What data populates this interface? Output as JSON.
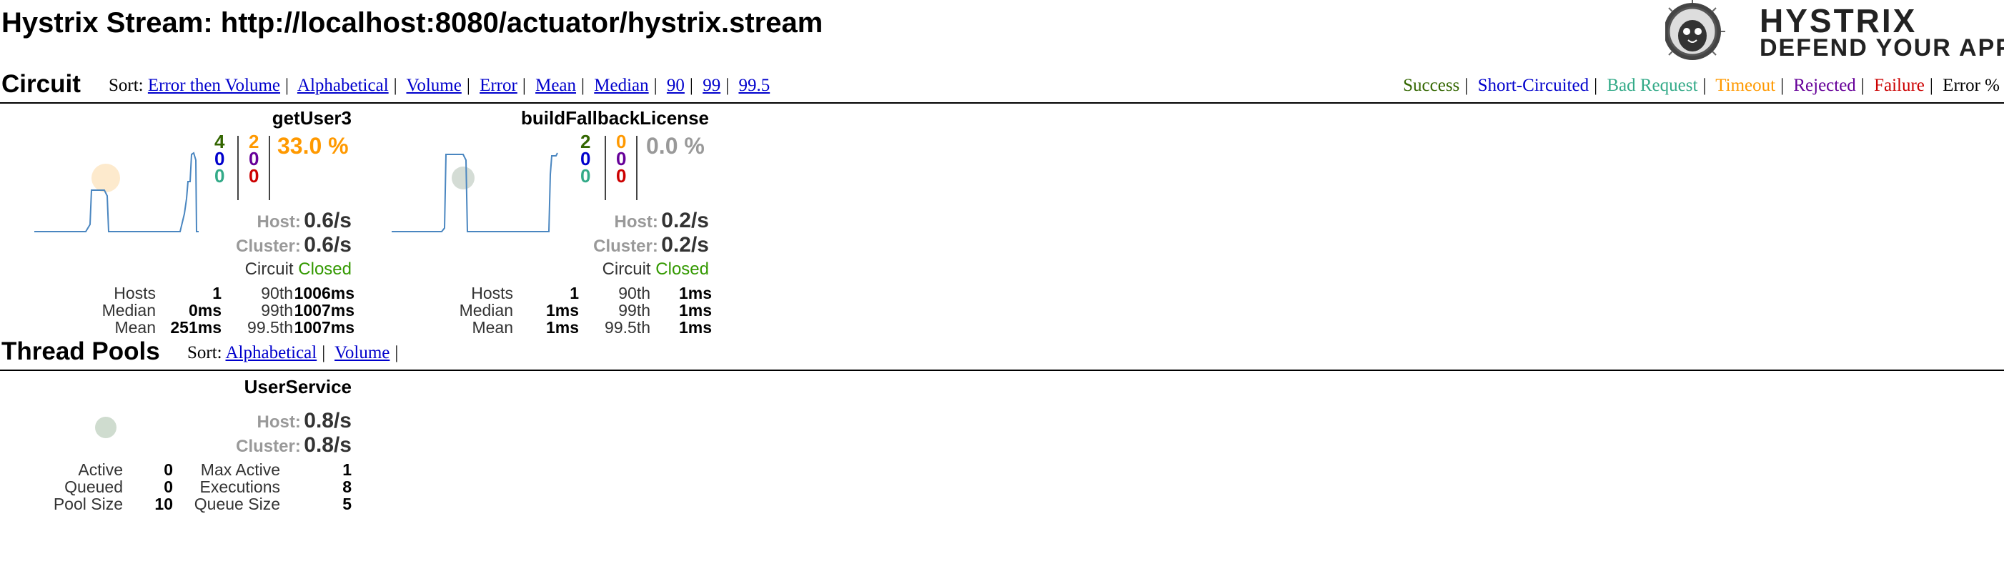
{
  "header": {
    "title": "Hystrix Stream: http://localhost:8080/actuator/hystrix.stream",
    "logo_line1": "HYSTRIX",
    "logo_line2": "DEFEND YOUR APP"
  },
  "circuit_section": {
    "title": "Circuit",
    "sort_label": "Sort:",
    "sort_options": [
      "Error then Volume",
      "Alphabetical",
      "Volume",
      "Error",
      "Mean",
      "Median",
      "90",
      "99",
      "99.5"
    ]
  },
  "legend": {
    "items": [
      {
        "label": "Success",
        "color": "#336600"
      },
      {
        "label": "Short-Circuited",
        "color": "#0000cc"
      },
      {
        "label": "Bad Request",
        "color": "#33aa88"
      },
      {
        "label": "Timeout",
        "color": "#ff9900"
      },
      {
        "label": "Rejected",
        "color": "#660099"
      },
      {
        "label": "Failure",
        "color": "#cc0000"
      },
      {
        "label": "Error %",
        "color": "#000000"
      }
    ]
  },
  "circuits": [
    {
      "name": "getUser3",
      "success": "4",
      "short_circuited": "0",
      "bad_request": "0",
      "timeout": "2",
      "rejected": "0",
      "failure": "0",
      "error_pct": "33.0 %",
      "error_color": "#ff9900",
      "circle_color": "#fde8c8",
      "host_label": "Host:",
      "host_rate": "0.6/s",
      "cluster_label": "Cluster:",
      "cluster_rate": "0.6/s",
      "circuit_label": "Circuit",
      "circuit_status": "Closed",
      "stats": {
        "hosts_label": "Hosts",
        "hosts": "1",
        "median_label": "Median",
        "median": "0ms",
        "mean_label": "Mean",
        "mean": "251ms",
        "p90_label": "90th",
        "p90": "1006ms",
        "p99_label": "99th",
        "p99": "1007ms",
        "p995_label": "99.5th",
        "p995": "1007ms"
      }
    },
    {
      "name": "buildFallbackLicense",
      "success": "2",
      "short_circuited": "0",
      "bad_request": "0",
      "timeout": "0",
      "rejected": "0",
      "failure": "0",
      "error_pct": "0.0 %",
      "error_color": "#999999",
      "circle_color": "#cfd8d0",
      "host_label": "Host:",
      "host_rate": "0.2/s",
      "cluster_label": "Cluster:",
      "cluster_rate": "0.2/s",
      "circuit_label": "Circuit",
      "circuit_status": "Closed",
      "stats": {
        "hosts_label": "Hosts",
        "hosts": "1",
        "median_label": "Median",
        "median": "1ms",
        "mean_label": "Mean",
        "mean": "1ms",
        "p90_label": "90th",
        "p90": "1ms",
        "p99_label": "99th",
        "p99": "1ms",
        "p995_label": "99.5th",
        "p995": "1ms"
      }
    }
  ],
  "threadpool_section": {
    "title": "Thread Pools",
    "sort_label": "Sort:",
    "sort_options": [
      "Alphabetical",
      "Volume"
    ]
  },
  "threadpools": [
    {
      "name": "UserService",
      "circle_color": "#cfdccf",
      "host_label": "Host:",
      "host_rate": "0.8/s",
      "cluster_label": "Cluster:",
      "cluster_rate": "0.8/s",
      "active_label": "Active",
      "active": "0",
      "queued_label": "Queued",
      "queued": "0",
      "pool_size_label": "Pool Size",
      "pool_size": "10",
      "max_active_label": "Max Active",
      "max_active": "1",
      "executions_label": "Executions",
      "executions": "8",
      "queue_size_label": "Queue Size",
      "queue_size": "5"
    }
  ],
  "colors": {
    "success": "#336600",
    "short_circuited": "#0000cc",
    "bad_request": "#33aa88",
    "timeout": "#ff9900",
    "rejected": "#660099",
    "failure": "#cc0000",
    "closed": "#339900",
    "sparkline": "#4a86c0"
  }
}
